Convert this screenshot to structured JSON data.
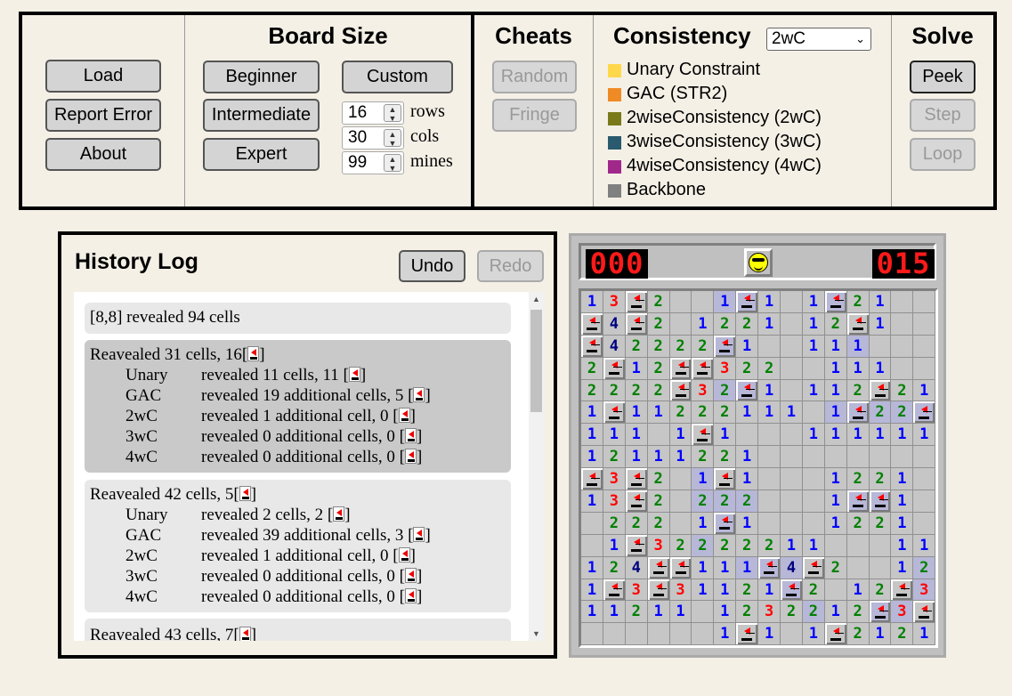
{
  "toolbar": {
    "load": "Load",
    "report_error": "Report Error",
    "about": "About",
    "board_size": {
      "title": "Board Size",
      "beginner": "Beginner",
      "intermediate": "Intermediate",
      "expert": "Expert",
      "custom": "Custom",
      "rows_value": "16",
      "rows_label": "rows",
      "cols_value": "30",
      "cols_label": "cols",
      "mines_value": "99",
      "mines_label": "mines"
    },
    "cheats": {
      "title": "Cheats",
      "random": "Random",
      "fringe": "Fringe"
    },
    "consistency": {
      "title": "Consistency",
      "selected": "2wC",
      "legend": [
        {
          "label": "Unary Constraint",
          "color": "#ffd84a"
        },
        {
          "label": "GAC (STR2)",
          "color": "#f08a24"
        },
        {
          "label": "2wiseConsistency (2wC)",
          "color": "#7a7a1a"
        },
        {
          "label": "3wiseConsistency (3wC)",
          "color": "#2a5a6e"
        },
        {
          "label": "4wiseConsistency (4wC)",
          "color": "#a0288a"
        },
        {
          "label": "Backbone",
          "color": "#808080"
        }
      ]
    },
    "solve": {
      "title": "Solve",
      "peek": "Peek",
      "step": "Step",
      "loop": "Loop"
    }
  },
  "history": {
    "title": "History Log",
    "undo": "Undo",
    "redo": "Redo",
    "entries": [
      {
        "header": "[8,8] revealed 94 cells",
        "rows": []
      },
      {
        "header": "Reavealed 31 cells, 16[",
        "rows": [
          {
            "name": "Unary",
            "text": "revealed 11 cells, 11 ["
          },
          {
            "name": "GAC",
            "text": "revealed 19 additional cells, 5 ["
          },
          {
            "name": "2wC",
            "text": "revealed 1 additional cell, 0 ["
          },
          {
            "name": "3wC",
            "text": "revealed 0 additional cells, 0 ["
          },
          {
            "name": "4wC",
            "text": "revealed 0 additional cells, 0 ["
          }
        ]
      },
      {
        "header": "Reavealed 42 cells, 5[",
        "rows": [
          {
            "name": "Unary",
            "text": "revealed 2 cells, 2 ["
          },
          {
            "name": "GAC",
            "text": "revealed 39 additional cells, 3 ["
          },
          {
            "name": "2wC",
            "text": "revealed 1 additional cell, 0 ["
          },
          {
            "name": "3wC",
            "text": "revealed 0 additional cells, 0 ["
          },
          {
            "name": "4wC",
            "text": "revealed 0 additional cells, 0 ["
          }
        ]
      },
      {
        "header": "Reavealed 43 cells, 7[",
        "rows": []
      }
    ]
  },
  "game": {
    "mines_counter": "000",
    "timer": "015",
    "face": "sunglasses-face",
    "board": [
      "13F2  1F1 1F21 ",
      "F4F2 1221 12F1 ",
      "F42222F1  111  ",
      "2F12FF322  111 ",
      "2222F32F1 112F21",
      "1F11222111 1F22F1",
      "111 1F1   111111",
      "12111221        ",
      "F3F2 1F1   1221 ",
      "13F2 222   1FF1 ",
      " 222 1F1   1221 ",
      " 1F32222211   11",
      "124FF111F4F2  12F",
      "1F3F31121F2 12F3",
      "11211 1232212F3F",
      "      1F1 1F2121"
    ],
    "highlight": [
      "      XX   X    ",
      "                ",
      "      X     X   ",
      "                ",
      "      XX        ",
      "           XXXXX",
      "                ",
      "                ",
      "     X          ",
      "     XXX    XX  ",
      "      X         ",
      "     X          ",
      "       XXX     X",
      "         X     X",
      "          X  XX ",
      "                "
    ]
  }
}
